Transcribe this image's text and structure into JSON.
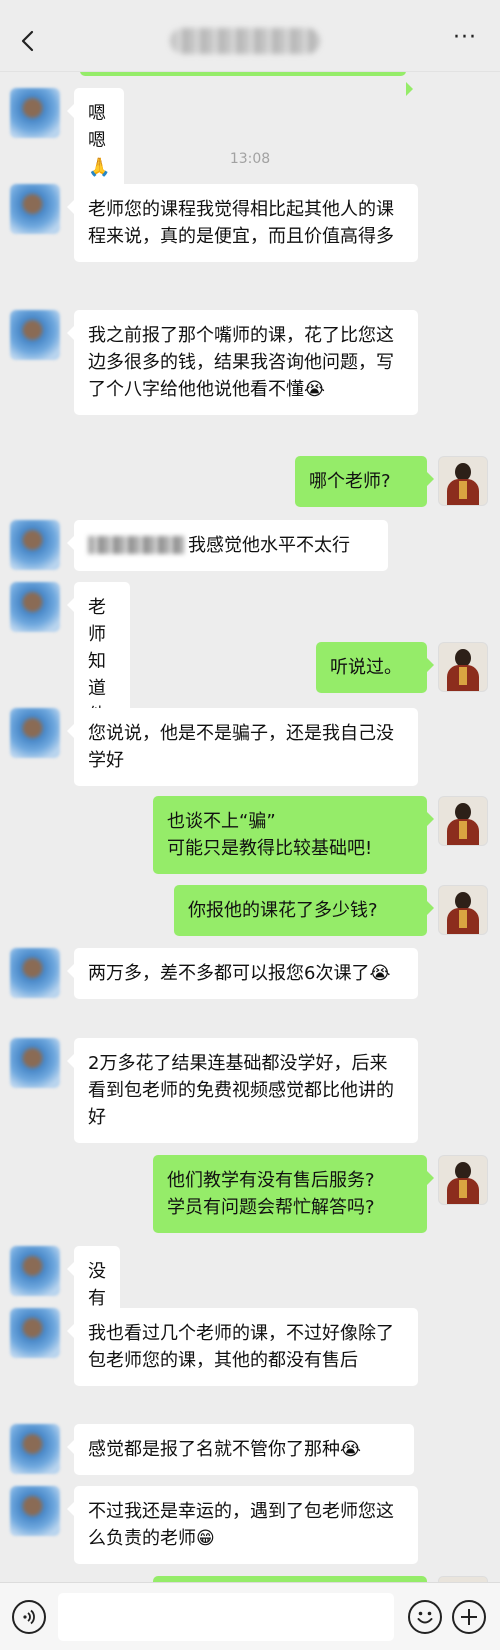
{
  "header": {
    "back_icon": "chevron-left-icon",
    "more_label": "···"
  },
  "messages": [
    {
      "side": "left",
      "text": "嗯嗯🙏"
    },
    {
      "type": "time",
      "text": "13:08"
    },
    {
      "side": "left",
      "text": "老师您的课程我觉得相比起其他人的课程来说，真的是便宜，而且价值高得多"
    },
    {
      "side": "left",
      "text": "我之前报了那个嘴师的课，花了比您这边多很多的钱，结果我咨询他问题，写了个八字给他他说他看不懂😭"
    },
    {
      "side": "right",
      "text": "哪个老师?"
    },
    {
      "side": "left",
      "text": "我感觉他水平不太行",
      "redacted_prefix": true
    },
    {
      "side": "left",
      "text": "老师知道他吗?"
    },
    {
      "side": "right",
      "text": "听说过。"
    },
    {
      "side": "left",
      "text": "您说说，他是不是骗子，还是我自己没学好"
    },
    {
      "side": "right",
      "text": "也谈不上“骗”\n可能只是教得比较基础吧!"
    },
    {
      "side": "right",
      "text": "你报他的课花了多少钱?"
    },
    {
      "side": "left",
      "text": "两万多，差不多都可以报您6次课了😭"
    },
    {
      "side": "left",
      "text": "2万多花了结果连基础都没学好，后来看到包老师的免费视频感觉都比他讲的好"
    },
    {
      "side": "right",
      "text": "他们教学有没有售后服务?\n学员有问题会帮忙解答吗?"
    },
    {
      "side": "left",
      "text": "没有"
    },
    {
      "side": "left",
      "text": "我也看过几个老师的课，不过好像除了包老师您的课，其他的都没有售后"
    },
    {
      "side": "left",
      "text": "感觉都是报了名就不管你了那种😭"
    },
    {
      "side": "left",
      "text": "不过我还是幸运的，遇到了包老师您这么负责的老师😁"
    }
  ],
  "input_bar": {
    "voice_icon": "voice-icon",
    "placeholder": "",
    "emoji_icon": "emoji-icon",
    "plus_icon": "plus-icon"
  }
}
